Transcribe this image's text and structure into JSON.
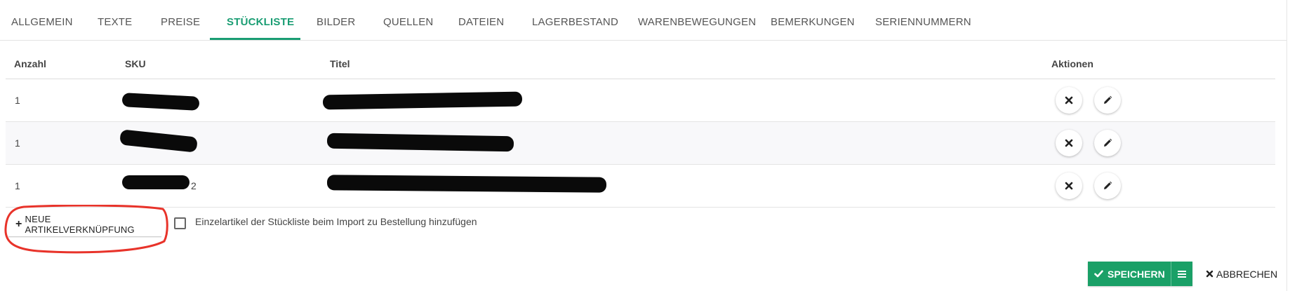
{
  "tabs": [
    {
      "label": "ALLGEMEIN"
    },
    {
      "label": "TEXTE"
    },
    {
      "label": "PREISE"
    },
    {
      "label": "STÜCKLISTE",
      "active": true
    },
    {
      "label": "BILDER"
    },
    {
      "label": "QUELLEN"
    },
    {
      "label": "DATEIEN"
    },
    {
      "label": "LAGERBESTAND"
    },
    {
      "label": "WARENBEWEGUNGEN"
    },
    {
      "label": "BEMERKUNGEN"
    },
    {
      "label": "SERIENNUMMERN"
    }
  ],
  "table": {
    "headers": {
      "quantity": "Anzahl",
      "sku": "SKU",
      "title": "Titel",
      "actions": "Aktionen"
    },
    "rows": [
      {
        "quantity": "1",
        "sku": "",
        "title": ""
      },
      {
        "quantity": "1",
        "sku": "",
        "title": ""
      },
      {
        "quantity": "1",
        "sku": "2",
        "title": ""
      }
    ]
  },
  "add_link_button": {
    "label": "NEUE ARTIKELVERKNÜPFUNG",
    "icon": "plus-icon"
  },
  "import_option": {
    "label": "Einzelartikel der Stückliste beim Import zu Bestellung hinzufügen",
    "checked": false
  },
  "footer": {
    "save_label": "SPEICHERN",
    "cancel_label": "ABBRECHEN"
  },
  "colors": {
    "accent": "#1a9d73",
    "save_button": "#1aa067",
    "annotation": "#e8332a"
  }
}
